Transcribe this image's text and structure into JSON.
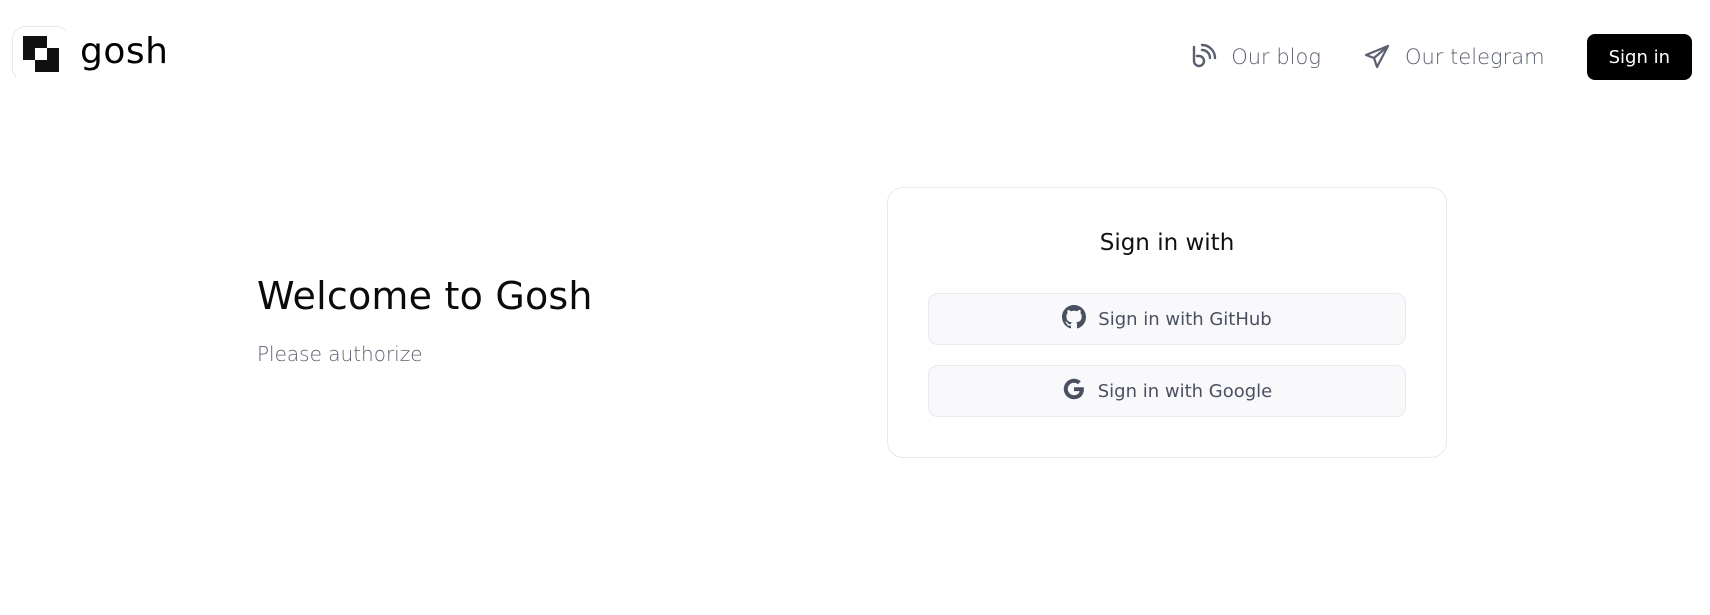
{
  "header": {
    "logo_text": "gosh",
    "nav": {
      "blog_label": "Our blog",
      "telegram_label": "Our telegram",
      "signin_label": "Sign in"
    }
  },
  "main": {
    "welcome_title": "Welcome to Gosh",
    "welcome_subtitle": "Please authorize"
  },
  "signin_card": {
    "title": "Sign in with",
    "github_label": "Sign in with GitHub",
    "google_label": "Sign in with Google"
  },
  "icons": {
    "logo": "gosh-logo-icon",
    "blog": "blog-icon",
    "telegram": "telegram-icon",
    "github": "github-icon",
    "google": "google-icon"
  },
  "colors": {
    "primary_button": "#000000",
    "muted_text": "#5b6070",
    "card_border": "#e8e9ee",
    "provider_button_bg": "#f9f9fb"
  }
}
